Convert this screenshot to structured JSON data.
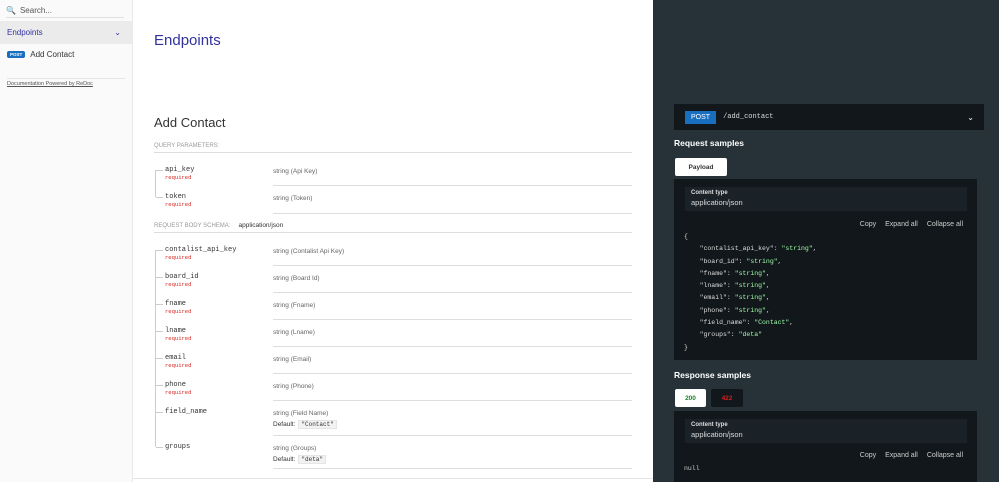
{
  "sidebar": {
    "search_placeholder": "Search...",
    "group": "Endpoints",
    "item_method": "POST",
    "item_label": "Add Contact",
    "powered": "Documentation Powered by ReDoc"
  },
  "main": {
    "title": "Endpoints",
    "operation": "Add Contact",
    "query_label": "QUERY PARAMETERS:",
    "body_label": "REQUEST BODY SCHEMA:",
    "body_type": "application/json",
    "query_params": [
      {
        "name": "api_key",
        "required": "required",
        "type": "string (Api Key)"
      },
      {
        "name": "token",
        "required": "required",
        "type": "string (Token)"
      }
    ],
    "body_params": [
      {
        "name": "contalist_api_key",
        "required": "required",
        "type": "string (Contalist Api Key)"
      },
      {
        "name": "board_id",
        "required": "required",
        "type": "string (Board Id)"
      },
      {
        "name": "fname",
        "required": "required",
        "type": "string (Fname)"
      },
      {
        "name": "lname",
        "required": "required",
        "type": "string (Lname)"
      },
      {
        "name": "email",
        "required": "required",
        "type": "string (Email)"
      },
      {
        "name": "phone",
        "required": "required",
        "type": "string (Phone)"
      },
      {
        "name": "field_name",
        "type": "string (Field Name)",
        "default_label": "Default:",
        "default": "\"Contact\""
      },
      {
        "name": "groups",
        "type": "string (Groups)",
        "default_label": "Default:",
        "default": "\"deta\""
      }
    ]
  },
  "panel": {
    "method": "POST",
    "path": "/add_contact",
    "request_title": "Request samples",
    "payload_tab": "Payload",
    "content_type_label": "Content type",
    "content_type": "application/json",
    "copy": "Copy",
    "expand": "Expand all",
    "collapse": "Collapse all",
    "payload": [
      [
        "contalist_api_key",
        "string"
      ],
      [
        "board_id",
        "string"
      ],
      [
        "fname",
        "string"
      ],
      [
        "lname",
        "string"
      ],
      [
        "email",
        "string"
      ],
      [
        "phone",
        "string"
      ],
      [
        "field_name",
        "Contact"
      ],
      [
        "groups",
        "deta"
      ]
    ],
    "response_title": "Response samples",
    "tab_200": "200",
    "tab_422": "422",
    "response_body": "null"
  },
  "colors": {
    "accent": "#32329f",
    "post": "#186fbf",
    "required": "#d41f1c",
    "panel": "#263238"
  }
}
